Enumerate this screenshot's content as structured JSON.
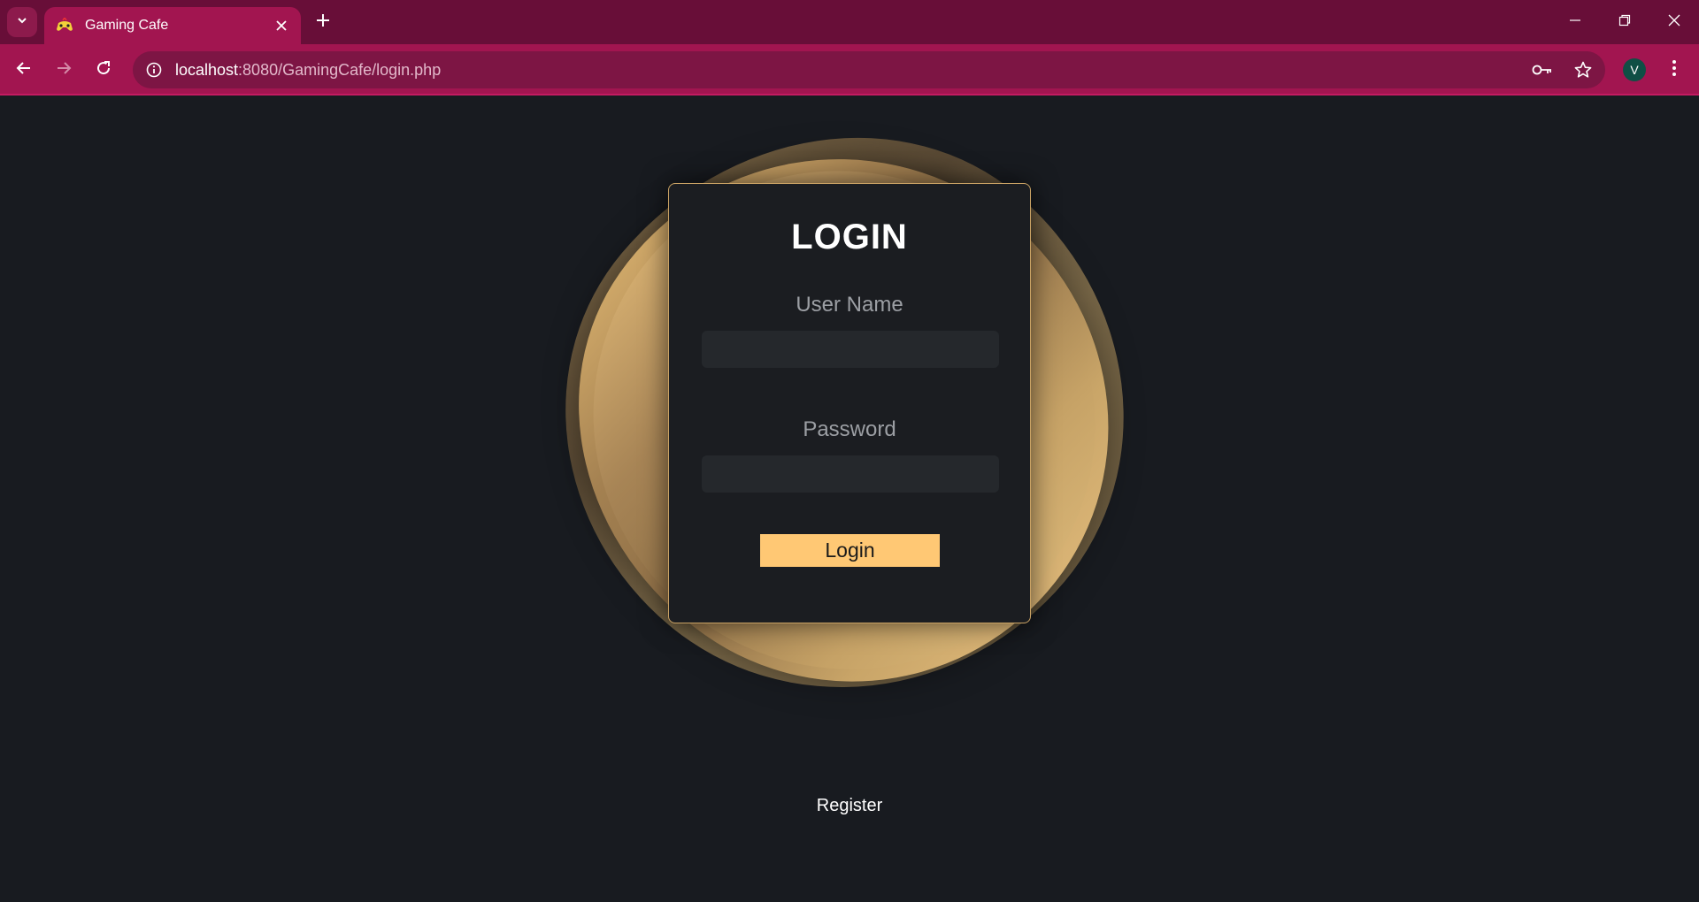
{
  "browser": {
    "tab_title": "Gaming Cafe",
    "url_host": "localhost",
    "url_path": ":8080/GamingCafe/login.php",
    "profile_initial": "V",
    "icons": {
      "tab_search": "chevron-down-icon",
      "favicon": "gamepad-icon",
      "tab_close": "close-icon",
      "new_tab": "plus-icon",
      "back": "arrow-left-icon",
      "forward": "arrow-right-icon",
      "reload": "reload-icon",
      "site_info": "info-icon",
      "password": "key-icon",
      "bookmark": "star-icon",
      "menu": "kebab-menu-icon",
      "minimize": "minimize-icon",
      "restore": "restore-icon",
      "close_window": "close-icon"
    },
    "colors": {
      "tabstrip": "#680e38",
      "toolbar": "#a21550"
    }
  },
  "login": {
    "title": "LOGIN",
    "username_label": "User Name",
    "username_value": "",
    "password_label": "Password",
    "password_value": "",
    "button_label": "Login",
    "register_label": "Register"
  },
  "colors": {
    "page_bg": "#181b20",
    "card_bg": "#1b1d21",
    "accent_gold": "#ffc874",
    "card_border": "#c9a264"
  }
}
